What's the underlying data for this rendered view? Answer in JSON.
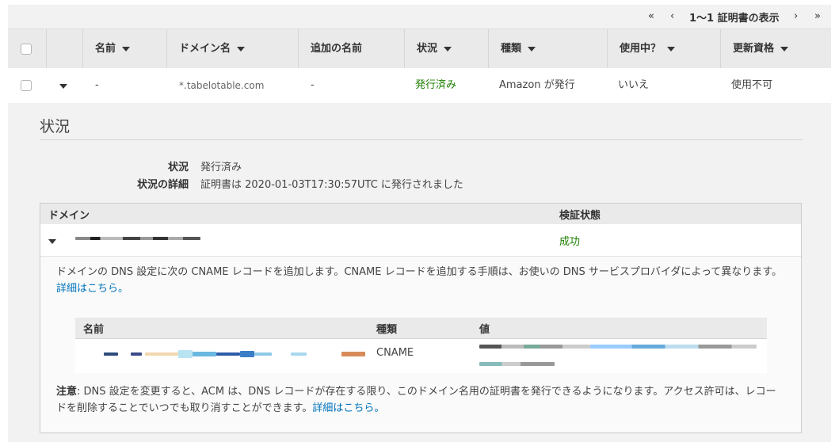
{
  "pager": {
    "first": "«",
    "prev": "‹",
    "text": "1〜1 証明書の表示",
    "next": "›",
    "last": "»"
  },
  "table": {
    "headers": {
      "name": "名前",
      "domain": "ドメイン名",
      "additional": "追加の名前",
      "status": "状況",
      "type": "種類",
      "in_use": "使用中？",
      "renewal": "更新資格"
    },
    "row": {
      "name": "-",
      "domain": "*.tabelotable.com",
      "additional": "-",
      "status": "発行済み",
      "type": "Amazon が発行",
      "in_use": "いいえ",
      "renewal": "使用不可"
    }
  },
  "detail": {
    "title": "状況",
    "status_label": "状況",
    "status_value": "発行済み",
    "detail_label": "状況の詳細",
    "detail_value": "証明書は 2020-01-03T17:30:57UTC に発行されました"
  },
  "domain_table": {
    "col_domain": "ドメイン",
    "col_status": "検証状態",
    "status": "成功",
    "desc_text": "ドメインの DNS 設定に次の CNAME レコードを追加します。CNAME レコードを追加する手順は、お使いの DNS サービスプロバイダによって異なります。",
    "desc_link": "詳細はこちら。",
    "cname": {
      "col_name": "名前",
      "col_type": "種類",
      "col_value": "値",
      "type": "CNAME"
    },
    "note_label": "注意",
    "note_text": ": DNS 設定を変更すると、ACM は、DNS レコードが存在する限り、このドメイン名用の証明書を発行できるようになります。アクセス許可は、レコードを削除することでいつでも取り消すことができます。",
    "note_link": "詳細はこちら。"
  },
  "colors": {
    "success": "#1d8102",
    "link": "#0073bb"
  }
}
